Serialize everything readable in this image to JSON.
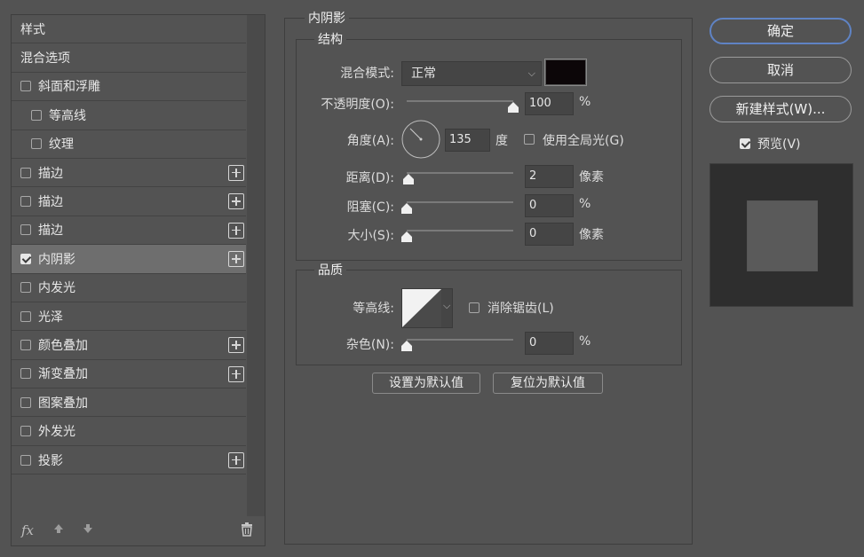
{
  "style_list": {
    "header_styles": "样式",
    "header_blend": "混合选项",
    "items": [
      {
        "label": "斜面和浮雕",
        "checked": false,
        "indent": false,
        "plus": false
      },
      {
        "label": "等高线",
        "checked": false,
        "indent": true,
        "plus": false
      },
      {
        "label": "纹理",
        "checked": false,
        "indent": true,
        "plus": false
      },
      {
        "label": "描边",
        "checked": false,
        "indent": false,
        "plus": true
      },
      {
        "label": "描边",
        "checked": false,
        "indent": false,
        "plus": true
      },
      {
        "label": "描边",
        "checked": false,
        "indent": false,
        "plus": true
      },
      {
        "label": "内阴影",
        "checked": true,
        "indent": false,
        "plus": true,
        "selected": true
      },
      {
        "label": "内发光",
        "checked": false,
        "indent": false,
        "plus": false
      },
      {
        "label": "光泽",
        "checked": false,
        "indent": false,
        "plus": false
      },
      {
        "label": "颜色叠加",
        "checked": false,
        "indent": false,
        "plus": true
      },
      {
        "label": "渐变叠加",
        "checked": false,
        "indent": false,
        "plus": true
      },
      {
        "label": "图案叠加",
        "checked": false,
        "indent": false,
        "plus": false
      },
      {
        "label": "外发光",
        "checked": false,
        "indent": false,
        "plus": false
      },
      {
        "label": "投影",
        "checked": false,
        "indent": false,
        "plus": true
      }
    ],
    "footer_fx": "fx"
  },
  "inner_shadow": {
    "title": "内阴影",
    "structure": {
      "title": "结构",
      "blend_mode_label": "混合模式:",
      "blend_mode_value": "正常",
      "shadow_color": "#0c0608",
      "opacity_label": "不透明度(O):",
      "opacity_value": "100",
      "opacity_unit": "%",
      "opacity_level": 1.0,
      "angle_label": "角度(A):",
      "angle_value": "135",
      "angle_unit": "度",
      "global_light_label": "使用全局光(G)",
      "global_light_checked": false,
      "distance_label": "距离(D):",
      "distance_value": "2",
      "distance_unit": "像素",
      "distance_level": 0.02,
      "choke_label": "阻塞(C):",
      "choke_value": "0",
      "choke_unit": "%",
      "choke_level": 0,
      "size_label": "大小(S):",
      "size_value": "0",
      "size_unit": "像素",
      "size_level": 0
    },
    "quality": {
      "title": "品质",
      "contour_label": "等高线:",
      "antialias_label": "消除锯齿(L)",
      "antialias_checked": false,
      "noise_label": "杂色(N):",
      "noise_value": "0",
      "noise_unit": "%",
      "noise_level": 0
    },
    "set_default_label": "设置为默认值",
    "reset_default_label": "复位为默认值"
  },
  "right": {
    "ok_label": "确定",
    "cancel_label": "取消",
    "new_style_label": "新建样式(W)...",
    "preview_label": "预览(V)",
    "preview_checked": true
  }
}
